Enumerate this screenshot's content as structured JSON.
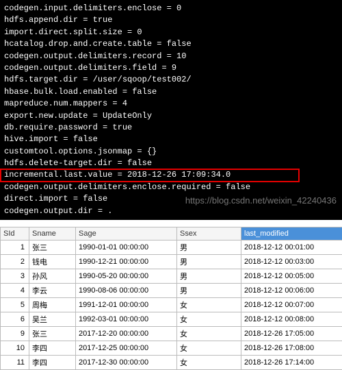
{
  "terminal": {
    "lines": [
      "codegen.input.delimiters.enclose = 0",
      "hdfs.append.dir = true",
      "import.direct.split.size = 0",
      "hcatalog.drop.and.create.table = false",
      "codegen.output.delimiters.record = 10",
      "codegen.output.delimiters.field = 9",
      "hdfs.target.dir = /user/sqoop/test002/",
      "hbase.bulk.load.enabled = false",
      "mapreduce.num.mappers = 4",
      "export.new.update = UpdateOnly",
      "db.require.password = true",
      "hive.import = false",
      "customtool.options.jsonmap = {}",
      "hdfs.delete-target.dir = false",
      "incremental.last.value = 2018-12-26 17:09:34.0",
      "codegen.output.delimiters.enclose.required = false",
      "direct.import = false",
      "codegen.output.dir = ."
    ],
    "highlighted_index": 14,
    "watermark": "https://blog.csdn.net/weixin_42240436"
  },
  "table": {
    "columns": [
      "SId",
      "Sname",
      "Sage",
      "Ssex",
      "last_modified"
    ],
    "selected_column_index": 4,
    "rows": [
      {
        "sid": "1",
        "sname": "张三",
        "sage": "1990-01-01 00:00:00",
        "ssex": "男",
        "last_modified": "2018-12-12 00:01:00"
      },
      {
        "sid": "2",
        "sname": "钱电",
        "sage": "1990-12-21 00:00:00",
        "ssex": "男",
        "last_modified": "2018-12-12 00:03:00"
      },
      {
        "sid": "3",
        "sname": "孙风",
        "sage": "1990-05-20 00:00:00",
        "ssex": "男",
        "last_modified": "2018-12-12 00:05:00"
      },
      {
        "sid": "4",
        "sname": "李云",
        "sage": "1990-08-06 00:00:00",
        "ssex": "男",
        "last_modified": "2018-12-12 00:06:00"
      },
      {
        "sid": "5",
        "sname": "周梅",
        "sage": "1991-12-01 00:00:00",
        "ssex": "女",
        "last_modified": "2018-12-12 00:07:00"
      },
      {
        "sid": "6",
        "sname": "吴兰",
        "sage": "1992-03-01 00:00:00",
        "ssex": "女",
        "last_modified": "2018-12-12 00:08:00"
      },
      {
        "sid": "9",
        "sname": "张三",
        "sage": "2017-12-20 00:00:00",
        "ssex": "女",
        "last_modified": "2018-12-26 17:05:00"
      },
      {
        "sid": "10",
        "sname": "李四",
        "sage": "2017-12-25 00:00:00",
        "ssex": "女",
        "last_modified": "2018-12-26 17:08:00"
      },
      {
        "sid": "11",
        "sname": "李四",
        "sage": "2017-12-30 00:00:00",
        "ssex": "女",
        "last_modified": "2018-12-26 17:14:00"
      }
    ]
  }
}
